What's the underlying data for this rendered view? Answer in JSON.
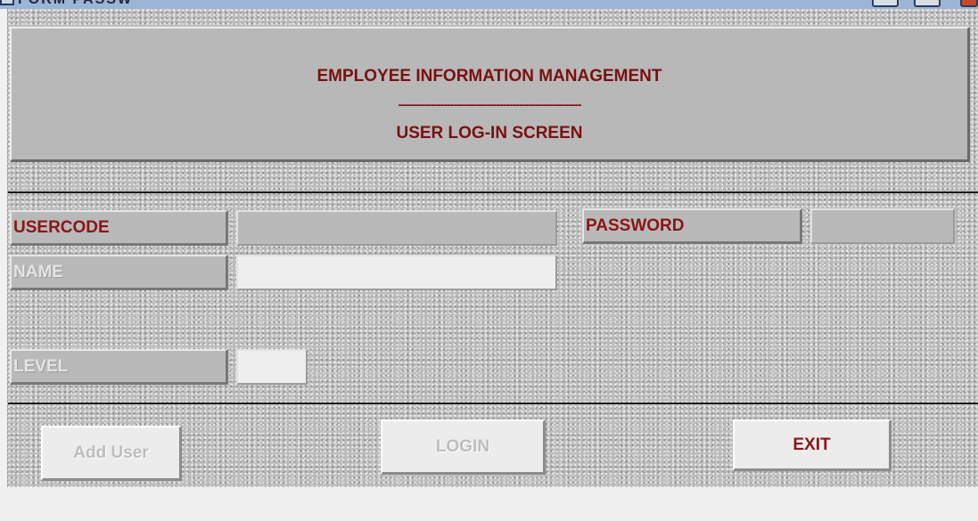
{
  "window": {
    "title": "FORM PASSW"
  },
  "header": {
    "title": "EMPLOYEE INFORMATION MANAGEMENT",
    "separator": "--------------------------------------------------------",
    "subtitle": "USER LOG-IN SCREEN"
  },
  "fields": {
    "usercode": {
      "label": "USERCODE",
      "value": ""
    },
    "password": {
      "label": "PASSWORD",
      "value": ""
    },
    "name": {
      "label": "NAME",
      "value": ""
    },
    "level": {
      "label": "LEVEL",
      "value": ""
    }
  },
  "buttons": {
    "add_user": "Add User",
    "login": "LOGIN",
    "exit": "EXIT"
  },
  "colors": {
    "label_text": "#8b1515",
    "form_background": "#bdbdbd",
    "disabled_text": "#bdbdbd"
  }
}
